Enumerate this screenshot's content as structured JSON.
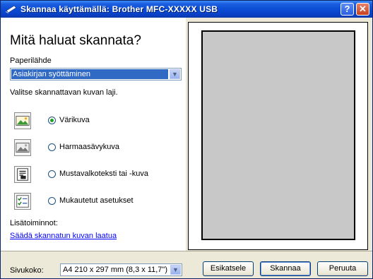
{
  "window": {
    "title": "Skannaa käyttämällä: Brother MFC-XXXXX USB",
    "help_glyph": "?",
    "close_glyph": "✕"
  },
  "main": {
    "heading": "Mitä haluat skannata?",
    "source_label": "Paperilähde",
    "source_value": "Asiakirjan syöttäminen",
    "type_label": "Valitse skannattavan kuvan laji.",
    "options": [
      {
        "label": "Värikuva",
        "selected": true,
        "icon": "color-photo-icon"
      },
      {
        "label": "Harmaasävykuva",
        "selected": false,
        "icon": "grayscale-photo-icon"
      },
      {
        "label": "Mustavalkoteksti tai -kuva",
        "selected": false,
        "icon": "bw-text-icon"
      },
      {
        "label": "Mukautetut asetukset",
        "selected": false,
        "icon": "custom-settings-icon"
      }
    ],
    "more_label": "Lisätoiminnot:",
    "adjust_link": "Säädä skannatun kuvan laatua"
  },
  "footer": {
    "page_size_label": "Sivukoko:",
    "page_size_value": "A4 210 x 297 mm (8,3 x 11,7\")",
    "preview_button": "Esikatsele",
    "scan_button": "Skannaa",
    "cancel_button": "Peruuta"
  },
  "colors": {
    "titlebar": "#0a4ad3",
    "selection": "#316ac5",
    "link": "#0000ff",
    "dialog_bg": "#ece9d8"
  }
}
